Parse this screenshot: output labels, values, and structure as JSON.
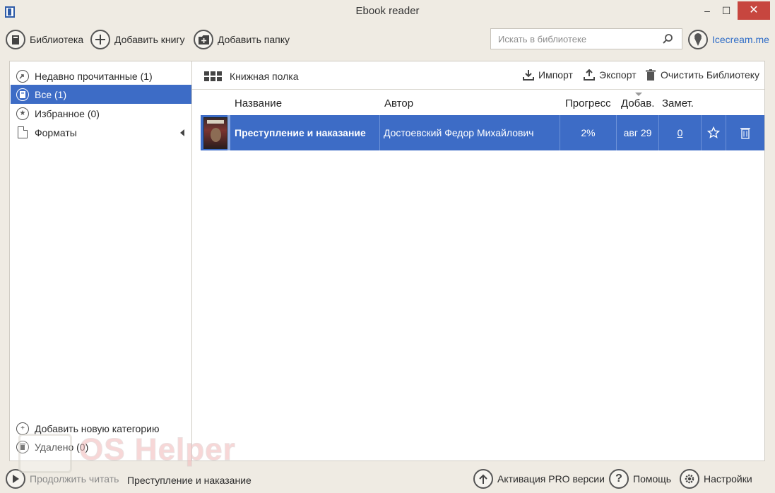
{
  "window": {
    "title": "Ebook reader",
    "min_label": "–",
    "max_label": "☐",
    "close_label": "✕"
  },
  "toolbar": {
    "library_label": "Библиотека",
    "add_book_label": "Добавить книгу",
    "add_folder_label": "Добавить папку",
    "search_placeholder": "Искать в библиотеке",
    "brand_link": "Icecream.me"
  },
  "sidebar": {
    "items": [
      {
        "label": "Недавно прочитанные (1)",
        "icon": "recent-icon"
      },
      {
        "label": "Все (1)",
        "icon": "book-icon",
        "active": true
      },
      {
        "label": "Избранное (0)",
        "icon": "star-icon"
      },
      {
        "label": "Форматы",
        "icon": "document-icon"
      }
    ],
    "add_category_label": "Добавить новую категорию",
    "deleted_label": "Удалено (0)"
  },
  "main": {
    "shelf_label": "Книжная полка",
    "import_label": "Импорт",
    "export_label": "Экспорт",
    "clear_label": "Очистить Библиотеку",
    "columns": {
      "title": "Название",
      "author": "Автор",
      "progress": "Прогресс",
      "added": "Добав.",
      "notes": "Замет."
    },
    "books": [
      {
        "title": "Преступление и наказание",
        "author": "Достоевский Федор Михайлович",
        "progress": "2%",
        "added": "авг 29",
        "notes": "0"
      }
    ]
  },
  "footer": {
    "continue_label": "Продолжить читать",
    "current_book": "Преступление и наказание",
    "pro_label": "Активация PRO версии",
    "help_label": "Помощь",
    "settings_label": "Настройки"
  },
  "watermark": "OS Helper",
  "colors": {
    "accent": "#3d6cc6",
    "background": "#efebe3",
    "close_button": "#c7463f",
    "link": "#2e6cc7"
  }
}
